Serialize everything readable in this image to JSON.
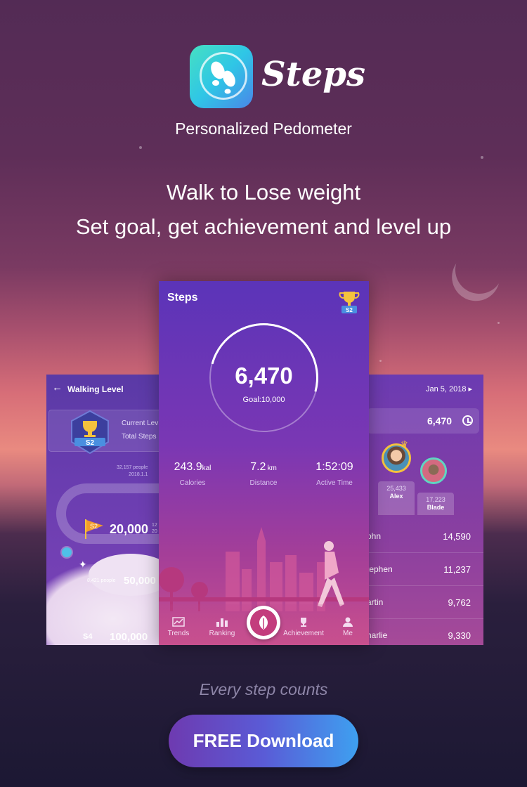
{
  "app": {
    "name": "Steps",
    "subtitle": "Personalized Pedometer",
    "tagline_1": "Walk to Lose weight",
    "tagline_2": "Set goal, get achievement and level up"
  },
  "left_screen": {
    "title": "Walking Level",
    "level_label": "Current Lev",
    "total_label": "Total Steps",
    "badge": "S2",
    "stat_people": "32,157 people",
    "stat_date": "2018.1.1",
    "level_s2_flag": "S2",
    "level_s2_value": "20,000",
    "level_s2_side_1": "12",
    "level_s2_side_2": "20",
    "level_s3_people": "8,421 people",
    "level_s3_value": "50,000",
    "level_s4_flag": "S4",
    "level_s4_value": "100,000"
  },
  "center_screen": {
    "title": "Steps",
    "trophy_badge": "S2",
    "steps": "6,470",
    "goal": "Goal:10,000",
    "metrics": [
      {
        "value": "243.9",
        "unit": "kal",
        "label": "Calories"
      },
      {
        "value": "7.2",
        "unit": "km",
        "label": "Distance"
      },
      {
        "value": "1:52:09",
        "unit": "",
        "label": "Active Time"
      }
    ],
    "nav": [
      {
        "label": "Trends",
        "icon": "trends-icon"
      },
      {
        "label": "Ranking",
        "icon": "ranking-icon"
      },
      {
        "label": "Achievement",
        "icon": "achievement-icon"
      },
      {
        "label": "Me",
        "icon": "profile-icon"
      }
    ]
  },
  "right_screen": {
    "date": "Jan 5, 2018",
    "my_steps": "6,470",
    "podium": [
      {
        "value": "25,433",
        "name": "Alex"
      },
      {
        "value": "17,223",
        "name": "Blade"
      }
    ],
    "rows": [
      {
        "name": "ohn",
        "value": "14,590"
      },
      {
        "name": "tephen",
        "value": "11,237"
      },
      {
        "name": "artin",
        "value": "9,762"
      },
      {
        "name": "harlie",
        "value": "9,330"
      }
    ]
  },
  "footer": {
    "caption": "Every step counts",
    "cta": "FREE Download"
  },
  "colors": {
    "accent_cta_start": "#6e3ab0",
    "accent_cta_end": "#3ea0f0",
    "icon_gradient_start": "#46e0c2",
    "icon_gradient_end": "#4a86e8"
  }
}
